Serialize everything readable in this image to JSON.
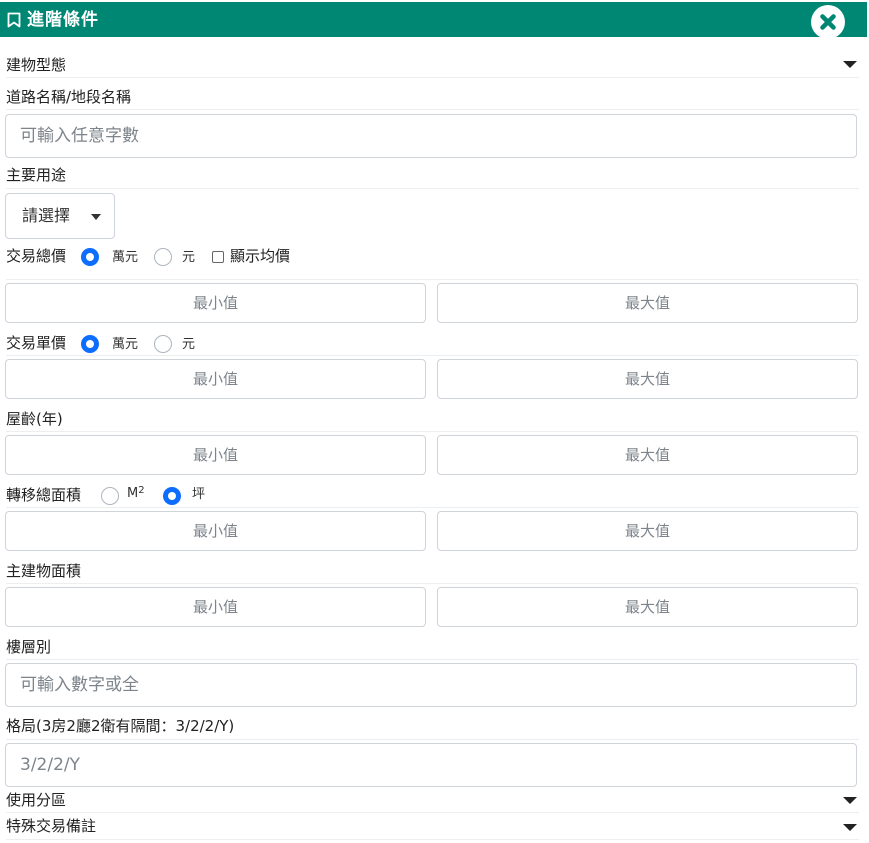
{
  "header": {
    "title": "進階條件",
    "bookmark_icon": "bookmark-icon",
    "close_icon": "close-circle-icon",
    "color": "#008774"
  },
  "building_type": {
    "label": "建物型態"
  },
  "road": {
    "label": "道路名稱/地段名稱",
    "placeholder": "可輸入任意字數"
  },
  "usage": {
    "label": "主要用途",
    "select_label": "請選擇"
  },
  "total_price": {
    "label": "交易總價",
    "unit_wan": "萬元",
    "unit_yuan": "元",
    "avg_label": "顯示均價",
    "selected": "萬元",
    "min_placeholder": "最小值",
    "max_placeholder": "最大值"
  },
  "unit_price": {
    "label": "交易單價",
    "unit_wan": "萬元",
    "unit_yuan": "元",
    "selected": "萬元",
    "min_placeholder": "最小值",
    "max_placeholder": "最大值"
  },
  "age": {
    "label": "屋齡(年)",
    "min_placeholder": "最小值",
    "max_placeholder": "最大值"
  },
  "transfer_area": {
    "label": "轉移總面積",
    "unit_m": "M",
    "unit_m_sup": "2",
    "unit_ping": "坪",
    "selected": "坪",
    "min_placeholder": "最小值",
    "max_placeholder": "最大值"
  },
  "main_area": {
    "label": "主建物面積",
    "min_placeholder": "最小值",
    "max_placeholder": "最大值"
  },
  "floor": {
    "label": "樓層別",
    "placeholder": "可輸入數字或全"
  },
  "layout": {
    "label": "格局(3房2廳2衛有隔間：3/2/2/Y)",
    "placeholder": "3/2/2/Y"
  },
  "zoning": {
    "label": "使用分區"
  },
  "special": {
    "label": "特殊交易備註"
  },
  "accent_color": "#0d6efd"
}
